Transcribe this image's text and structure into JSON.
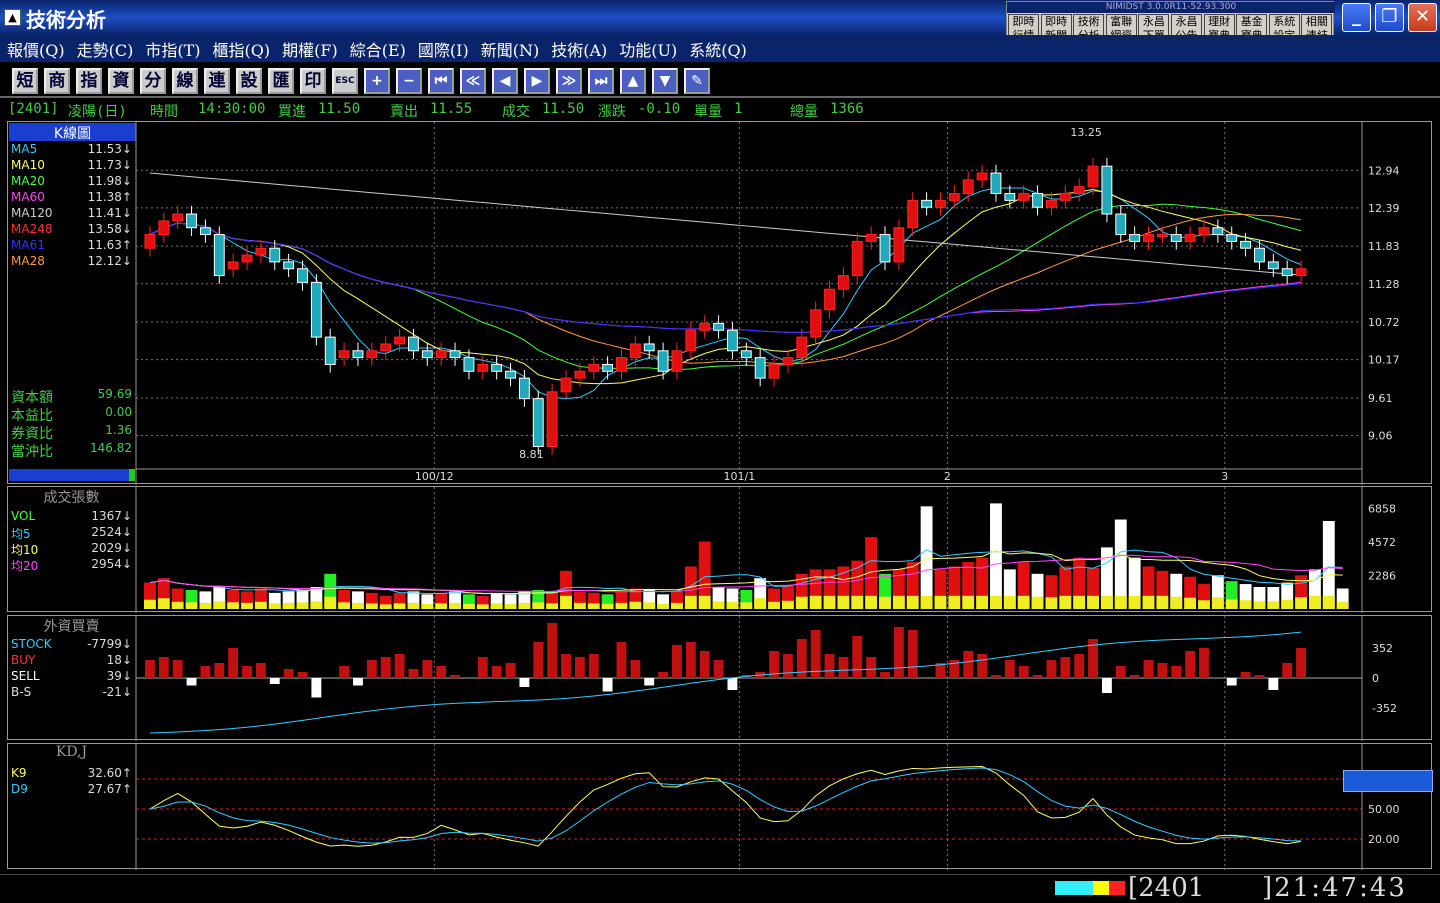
{
  "window": {
    "title": "技術分析",
    "version": "NIMIDST 3.0.0R11-52.93.300",
    "min": "_",
    "max": "❐",
    "close": "✕"
  },
  "quick_buttons": [
    [
      "即時",
      "行情"
    ],
    [
      "即時",
      "新聞"
    ],
    [
      "技術",
      "分析"
    ],
    [
      "富聯",
      "網資"
    ],
    [
      "永昌",
      "下單"
    ],
    [
      "永昌",
      "公告"
    ],
    [
      "理財",
      "寶典"
    ],
    [
      "基金",
      "寶典"
    ],
    [
      "系統",
      "設定"
    ],
    [
      "相關",
      "連結"
    ]
  ],
  "menu": [
    "報價(Q)",
    "走勢(C)",
    "市指(T)",
    "櫃指(Q)",
    "期權(F)",
    "綜合(E)",
    "國際(I)",
    "新聞(N)",
    "技術(A)",
    "功能(U)",
    "系統(Q)"
  ],
  "toolbar": [
    "短",
    "商",
    "指",
    "資",
    "分",
    "線",
    "連",
    "設",
    "匯",
    "印",
    "ESC",
    "+",
    "−",
    "⏮",
    "≪",
    "◀",
    "▶",
    "≫",
    "⏭",
    "▲",
    "▼",
    "✎"
  ],
  "info": {
    "code": "[2401]",
    "name": "凌陽(日)",
    "time_lbl": "時間",
    "time": "14:30:00",
    "bid_lbl": "買進",
    "bid": "11.50",
    "ask_lbl": "賣出",
    "ask": "11.55",
    "deal_lbl": "成交",
    "deal": "11.50",
    "chg_lbl": "漲跌",
    "chg": "-0.10",
    "unit_lbl": "單量",
    "unit": "1",
    "tot_lbl": "總量",
    "tot": "1366"
  },
  "kline": {
    "title": "K線圖",
    "ma": [
      {
        "name": "MA5",
        "value": "11.53↓",
        "color": "#3cf"
      },
      {
        "name": "MA10",
        "value": "11.73↓",
        "color": "#ff6"
      },
      {
        "name": "MA20",
        "value": "11.98↓",
        "color": "#4f4"
      },
      {
        "name": "MA60",
        "value": "11.38↑",
        "color": "#f4f"
      },
      {
        "name": "MA120",
        "value": "11.41↓",
        "color": "#ccc"
      },
      {
        "name": "MA248",
        "value": "13.58↓",
        "color": "#f33"
      },
      {
        "name": "MA61",
        "value": "11.63↑",
        "color": "#33f"
      },
      {
        "name": "MA28",
        "value": "12.12↓",
        "color": "#f94"
      }
    ],
    "stats": [
      {
        "name": "資本額",
        "value": "59.69"
      },
      {
        "name": "本益比",
        "value": "0.00"
      },
      {
        "name": "券資比",
        "value": "1.36"
      },
      {
        "name": "當沖比",
        "value": "146.82"
      }
    ],
    "y_ticks": [
      "12.94",
      "12.39",
      "11.83",
      "11.28",
      "10.72",
      "10.17",
      "9.61",
      "9.06"
    ],
    "x_ticks": [
      "100/12",
      "101/1",
      "2",
      "3"
    ],
    "high_label": "13.25",
    "low_label": "8.81"
  },
  "volume": {
    "title": "成交張數",
    "legend": [
      {
        "name": "VOL",
        "value": "1367↓",
        "color": "#4f4"
      },
      {
        "name": "均5",
        "value": "2524↓",
        "color": "#3cf"
      },
      {
        "name": "均10",
        "value": "2029↓",
        "color": "#ff6"
      },
      {
        "name": "均20",
        "value": "2954↓",
        "color": "#f4f"
      }
    ],
    "y_ticks": [
      "6858",
      "4572",
      "2286"
    ]
  },
  "foreign": {
    "title": "外資買賣",
    "legend": [
      {
        "name": "STOCK",
        "value": "-7799↓",
        "color": "#3cf"
      },
      {
        "name": "BUY",
        "value": "18↓",
        "color": "#f33"
      },
      {
        "name": "SELL",
        "value": "39↓",
        "color": "#fff"
      },
      {
        "name": "B-S",
        "value": "-21↓",
        "color": "#ddd"
      }
    ],
    "y_ticks": [
      "352",
      "0",
      "-352"
    ]
  },
  "kd": {
    "title": "KD,J",
    "legend": [
      {
        "name": "K9",
        "value": "32.60↑",
        "color": "#ff6"
      },
      {
        "name": "D9",
        "value": "27.67↑",
        "color": "#3cf"
      }
    ],
    "y_ticks": [
      "50.00",
      "20.00"
    ]
  },
  "status": {
    "code": "[2401",
    "clock": "]21:47:43"
  },
  "chart_data": {
    "type": "candlestick",
    "x_ticks": [
      "100/12",
      "101/1",
      "2",
      "3"
    ],
    "ylim": [
      8.6,
      13.5
    ],
    "close": [
      12.0,
      12.2,
      12.3,
      12.1,
      12.0,
      11.4,
      11.6,
      11.7,
      11.8,
      11.6,
      11.5,
      11.3,
      10.5,
      10.1,
      10.3,
      10.2,
      10.3,
      10.4,
      10.5,
      10.3,
      10.2,
      10.3,
      10.2,
      10.0,
      10.1,
      10.0,
      9.9,
      9.6,
      8.9,
      9.7,
      9.9,
      10.0,
      10.1,
      10.0,
      10.2,
      10.4,
      10.3,
      10.0,
      10.3,
      10.6,
      10.7,
      10.6,
      10.3,
      10.2,
      9.9,
      10.1,
      10.2,
      10.5,
      10.9,
      11.2,
      11.4,
      11.9,
      12.0,
      11.6,
      12.1,
      12.5,
      12.4,
      12.5,
      12.6,
      12.8,
      12.9,
      12.6,
      12.5,
      12.6,
      12.4,
      12.5,
      12.6,
      12.7,
      13.0,
      12.3,
      12.0,
      11.9,
      12.0,
      12.0,
      11.9,
      12.0,
      12.1,
      12.0,
      11.9,
      11.8,
      11.6,
      11.5,
      11.4,
      11.5
    ],
    "open": [
      11.8,
      12.0,
      12.2,
      12.3,
      12.1,
      12.0,
      11.5,
      11.6,
      11.7,
      11.8,
      11.6,
      11.5,
      11.3,
      10.5,
      10.2,
      10.3,
      10.2,
      10.3,
      10.4,
      10.5,
      10.3,
      10.2,
      10.3,
      10.2,
      10.0,
      10.1,
      10.0,
      9.9,
      9.6,
      8.9,
      9.7,
      9.9,
      10.0,
      10.1,
      10.0,
      10.2,
      10.4,
      10.3,
      10.0,
      10.3,
      10.6,
      10.7,
      10.6,
      10.3,
      10.2,
      9.9,
      10.1,
      10.2,
      10.5,
      10.9,
      11.2,
      11.4,
      11.9,
      12.0,
      11.6,
      12.1,
      12.5,
      12.4,
      12.5,
      12.6,
      12.8,
      12.9,
      12.6,
      12.5,
      12.6,
      12.4,
      12.5,
      12.6,
      12.7,
      13.0,
      12.3,
      12.0,
      11.9,
      12.0,
      12.0,
      11.9,
      12.0,
      12.1,
      12.0,
      11.9,
      11.8,
      11.6,
      11.5,
      11.4
    ],
    "volume": [
      1800,
      2100,
      1400,
      1300,
      1200,
      1500,
      1300,
      1200,
      1400,
      1100,
      1200,
      1300,
      1500,
      2400,
      1300,
      1200,
      1100,
      900,
      1100,
      1200,
      1000,
      1100,
      1200,
      1000,
      900,
      1100,
      1000,
      1200,
      1300,
      1100,
      2600,
      1200,
      1100,
      1000,
      1200,
      1400,
      1300,
      1000,
      1200,
      2900,
      4600,
      1500,
      1400,
      1300,
      2100,
      1400,
      1600,
      2400,
      2700,
      2700,
      2900,
      3300,
      4900,
      2400,
      2700,
      3200,
      7000,
      2700,
      2900,
      3200,
      3500,
      7200,
      2700,
      3200,
      2400,
      2300,
      2900,
      3500,
      2800,
      4200,
      6100,
      3500,
      2900,
      2600,
      2400,
      2200,
      1700,
      2300,
      1900,
      1700,
      1500,
      1500,
      1800,
      2300,
      2700,
      6000,
      1400
    ]
  }
}
